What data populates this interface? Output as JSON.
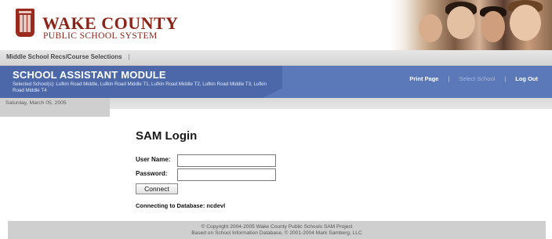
{
  "header": {
    "logo_title": "WAKE COUNTY",
    "logo_subtitle": "PUBLIC SCHOOL SYSTEM"
  },
  "crumb": {
    "label": "Middle School Recs/Course Selections",
    "separator": "|"
  },
  "module": {
    "title": "SCHOOL ASSISTANT MODULE",
    "schools": "Selected School(s): Lufkin Road Middle, Lufkin Road Middle T1, Lufkin Road Middle T2, Lufkin Road Middle T3, Lufkin Road Middle T4"
  },
  "topnav": {
    "print_page": "Print Page",
    "select_school": "Select School",
    "log_out": "Log Out",
    "separator": "|"
  },
  "date": "Saturday, March 05, 2005",
  "login": {
    "title": "SAM Login",
    "username_label": "User Name:",
    "username_value": "",
    "password_label": "Password:",
    "password_value": "",
    "connect_label": "Connect",
    "db_status": "Connecting to Database: ncdevl"
  },
  "footer": {
    "line1": "© Copyright 2004-2005 Wake County Public Schools SAM Project",
    "line2": "Based on School Information Database, © 2001-2004 Mark Samberg, LLC"
  },
  "colors": {
    "brand_red": "#8a2418",
    "module_blue": "#5b78b8",
    "module_tab_blue": "#4c68a9"
  }
}
